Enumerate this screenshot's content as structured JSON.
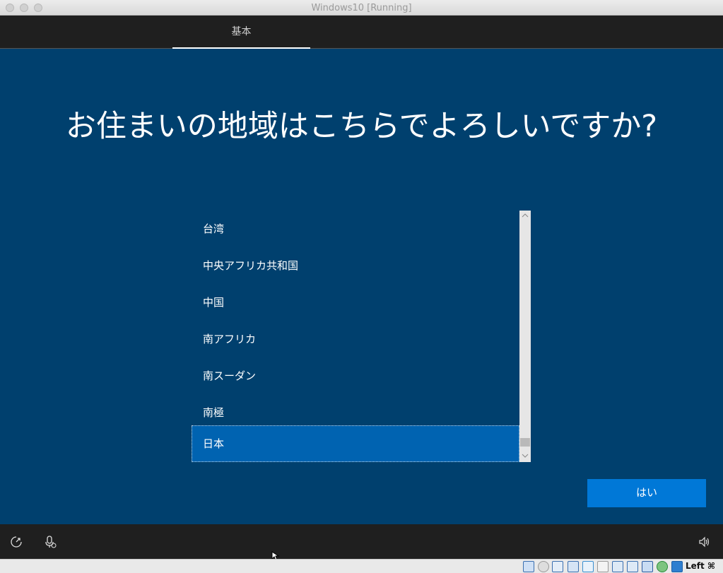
{
  "window": {
    "title": "Windows10 [Running]"
  },
  "topbar": {
    "tab_label": "基本"
  },
  "page": {
    "heading": "お住まいの地域はこちらでよろしいですか?"
  },
  "region_list": {
    "items": [
      {
        "label": "台湾",
        "selected": false
      },
      {
        "label": "中央アフリカ共和国",
        "selected": false
      },
      {
        "label": "中国",
        "selected": false
      },
      {
        "label": "南アフリカ",
        "selected": false
      },
      {
        "label": "南スーダン",
        "selected": false
      },
      {
        "label": "南極",
        "selected": false
      },
      {
        "label": "日本",
        "selected": true
      }
    ],
    "scroll_position": 0.93
  },
  "actions": {
    "yes_label": "はい"
  },
  "bottombar": {
    "icons": [
      "ease-of-access-icon",
      "microphone-icon",
      "volume-icon"
    ]
  },
  "statusbar": {
    "host_key": "Left ⌘",
    "icons": [
      "hard-disk-icon",
      "optical-drive-icon",
      "audio-icon",
      "network-icon",
      "usb-icon",
      "shared-folders-icon",
      "display-icon",
      "video-capture-icon",
      "vbox-icon",
      "globe-icon",
      "download-icon"
    ]
  },
  "colors": {
    "background": "#00406e",
    "selected_item": "#0063b1",
    "button": "#0078d7",
    "bars": "#1f1f1f"
  }
}
